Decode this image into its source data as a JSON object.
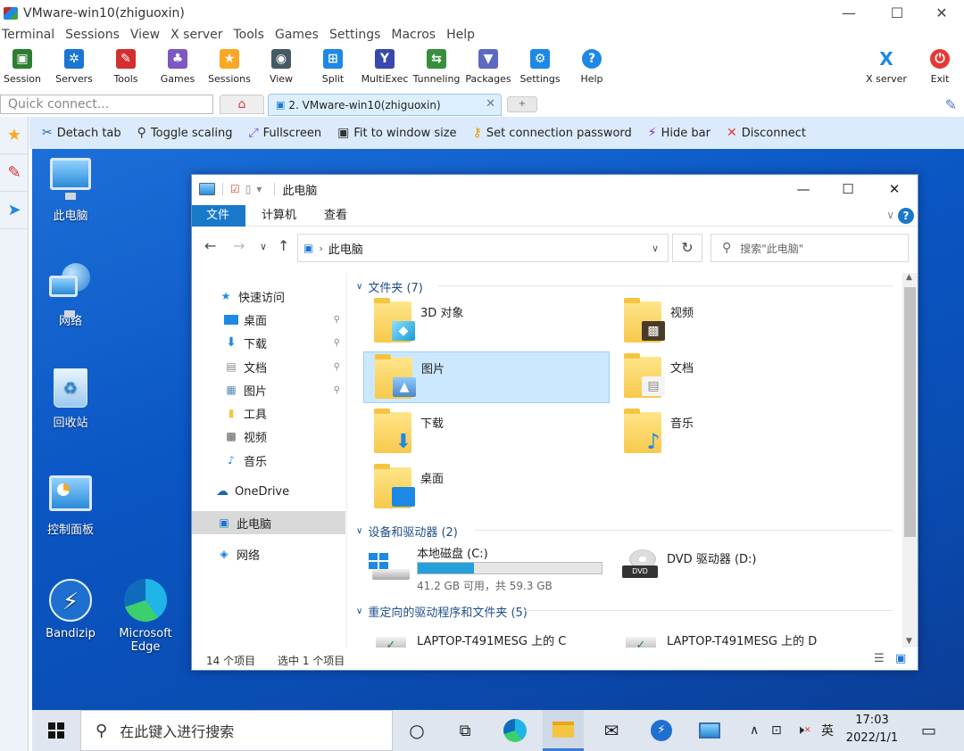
{
  "window": {
    "title": "VMware-win10(zhiguoxin)",
    "controls": {
      "minimize": "—",
      "maximize": "☐",
      "close": "✕"
    }
  },
  "menu": [
    "Terminal",
    "Sessions",
    "View",
    "X server",
    "Tools",
    "Games",
    "Settings",
    "Macros",
    "Help"
  ],
  "toolbar": {
    "buttons": [
      {
        "label": "Session",
        "icon": "session-icon",
        "color": "#2e7d32"
      },
      {
        "label": "Servers",
        "icon": "servers-icon",
        "color": "#1976d2"
      },
      {
        "label": "Tools",
        "icon": "tools-icon",
        "color": "#d32f2f"
      },
      {
        "label": "Games",
        "icon": "games-icon",
        "color": "#7e57c2"
      },
      {
        "label": "Sessions",
        "icon": "star-icon",
        "color": "#f9a825"
      },
      {
        "label": "View",
        "icon": "view-icon",
        "color": "#455a64"
      },
      {
        "label": "Split",
        "icon": "split-icon",
        "color": "#1e88e5"
      },
      {
        "label": "MultiExec",
        "icon": "multiexec-icon",
        "color": "#3949ab"
      },
      {
        "label": "Tunneling",
        "icon": "tunneling-icon",
        "color": "#388e3c"
      },
      {
        "label": "Packages",
        "icon": "packages-icon",
        "color": "#5c6bc0"
      },
      {
        "label": "Settings",
        "icon": "gear-icon",
        "color": "#1e88e5"
      },
      {
        "label": "Help",
        "icon": "help-icon",
        "color": "#1e88e5"
      }
    ],
    "xserver_label": "X server",
    "exit_label": "Exit"
  },
  "tabs": {
    "quick_connect_placeholder": "Quick connect...",
    "session_tab_label": "2. VMware-win10(zhiguoxin)"
  },
  "actionbar": [
    {
      "label": "Detach tab",
      "icon": "scissors-icon"
    },
    {
      "label": "Toggle scaling",
      "icon": "magnifier-icon"
    },
    {
      "label": "Fullscreen",
      "icon": "fullscreen-icon"
    },
    {
      "label": "Fit to window size",
      "icon": "fit-icon"
    },
    {
      "label": "Set connection password",
      "icon": "key-icon"
    },
    {
      "label": "Hide bar",
      "icon": "lightning-icon"
    },
    {
      "label": "Disconnect",
      "icon": "close-icon"
    }
  ],
  "desktop": {
    "icons": [
      "此电脑",
      "网络",
      "回收站",
      "控制面板",
      "Bandizip",
      "Microsoft Edge"
    ]
  },
  "explorer": {
    "title": "此电脑",
    "ribbon_tabs": [
      "文件",
      "计算机",
      "查看"
    ],
    "address": "此电脑",
    "search_placeholder": "搜索\"此电脑\"",
    "nav": {
      "quick_access": "快速访问",
      "items": [
        "桌面",
        "下载",
        "文档",
        "图片",
        "工具",
        "视频",
        "音乐"
      ],
      "onedrive": "OneDrive",
      "this_pc": "此电脑",
      "network": "网络"
    },
    "groups": {
      "folders": "文件夹 (7)",
      "devices": "设备和驱动器 (2)",
      "redirected": "重定向的驱动程序和文件夹 (5)"
    },
    "folders": [
      "3D 对象",
      "视频",
      "图片",
      "文档",
      "下载",
      "音乐",
      "桌面"
    ],
    "drives": {
      "c_name": "本地磁盘 (C:)",
      "c_size": "41.2 GB 可用，共 59.3 GB",
      "c_used_fraction": 0.305,
      "d_name": "DVD 驱动器 (D:)"
    },
    "redirected": [
      "LAPTOP-T491MESG 上的 C",
      "LAPTOP-T491MESG 上的 D"
    ],
    "status": {
      "count": "14 个项目",
      "selected": "选中 1 个项目"
    }
  },
  "taskbar": {
    "search_placeholder": "在此键入进行搜索",
    "ime": "英",
    "time": "17:03",
    "date": "2022/1/1"
  }
}
